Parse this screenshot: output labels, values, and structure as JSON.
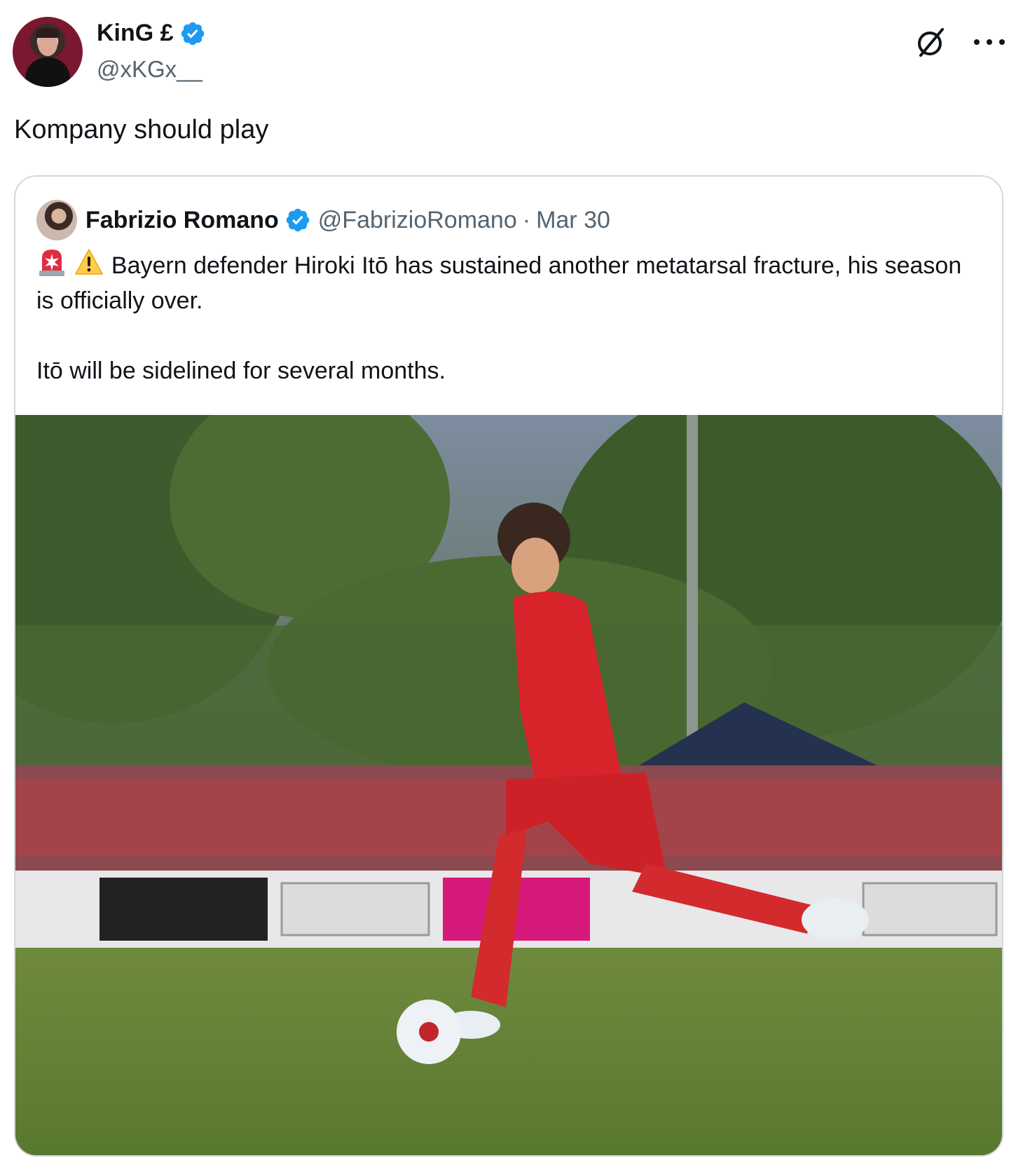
{
  "author": {
    "display_name": "KinG £",
    "handle": "@xKGx__"
  },
  "tweet": {
    "text": "Kompany should play"
  },
  "quoted": {
    "display_name": "Fabrizio Romano",
    "handle": "@FabrizioRomano",
    "separator": "·",
    "date": "Mar 30",
    "line1": "Bayern defender Hiroki Itō has sustained another metatarsal fracture, his season is officially over.",
    "line2": "Itō will be sidelined for several months.",
    "emojis": [
      "siren-emoji",
      "warning-emoji"
    ]
  },
  "colors": {
    "verified_blue": "#1d9bf0",
    "secondary_text": "#536471",
    "border": "#cfd9de"
  },
  "icons": [
    "verified-badge-icon",
    "grok-icon",
    "more-options-icon"
  ]
}
